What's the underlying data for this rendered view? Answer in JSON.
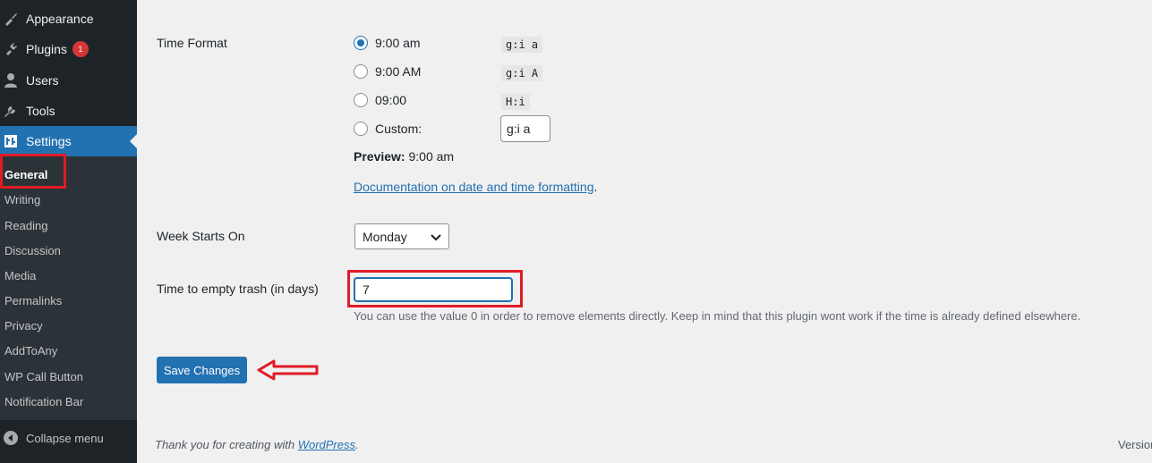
{
  "sidebar": {
    "top_items": [
      {
        "label": "Appearance",
        "icon": "brush-icon"
      },
      {
        "label": "Plugins",
        "icon": "plugin-icon",
        "badge": "1"
      },
      {
        "label": "Users",
        "icon": "user-icon"
      },
      {
        "label": "Tools",
        "icon": "wrench-icon"
      },
      {
        "label": "Settings",
        "icon": "settings-icon",
        "active": true
      }
    ],
    "submenu": [
      "General",
      "Writing",
      "Reading",
      "Discussion",
      "Media",
      "Permalinks",
      "Privacy",
      "AddToAny",
      "WP Call Button",
      "Notification Bar"
    ],
    "current_submenu": "General",
    "collapse_label": "Collapse menu"
  },
  "time_format": {
    "label": "Time Format",
    "options": [
      {
        "label": "9:00 am",
        "code": "g:i a",
        "checked": true
      },
      {
        "label": "9:00 AM",
        "code": "g:i A",
        "checked": false
      },
      {
        "label": "09:00",
        "code": "H:i",
        "checked": false
      },
      {
        "label": "Custom:",
        "checked": false
      }
    ],
    "custom_value": "g:i a",
    "preview_label": "Preview:",
    "preview_value": "9:00 am",
    "doc_link": "Documentation on date and time formatting",
    "doc_suffix": "."
  },
  "week_starts": {
    "label": "Week Starts On",
    "value": "Monday"
  },
  "trash": {
    "label": "Time to empty trash (in days)",
    "value": "7",
    "help": "You can use the value 0 in order to remove elements directly. Keep in mind that this plugin wont work if the time is already defined elsewhere."
  },
  "save_button": "Save Changes",
  "footer": {
    "text": "Thank you for creating with ",
    "link": "WordPress",
    "suffix": ".",
    "version": "Version"
  },
  "colors": {
    "accent": "#2271b1",
    "highlight": "#e01b24",
    "sidebar_bg": "#1d2327"
  }
}
